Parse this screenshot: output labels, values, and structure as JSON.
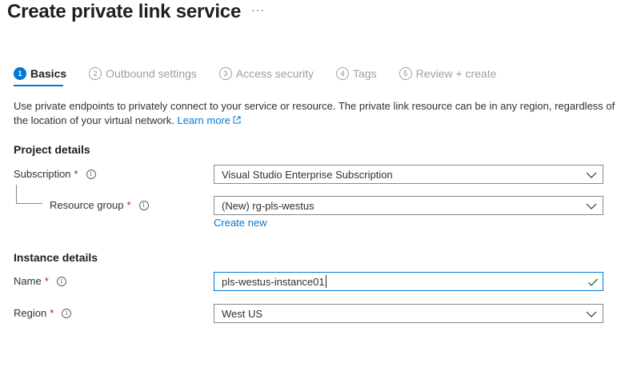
{
  "page": {
    "title": "Create private link service",
    "more_label": "···"
  },
  "tabs": [
    {
      "num": "1",
      "label": "Basics",
      "active": true
    },
    {
      "num": "2",
      "label": "Outbound settings",
      "active": false
    },
    {
      "num": "3",
      "label": "Access security",
      "active": false
    },
    {
      "num": "4",
      "label": "Tags",
      "active": false
    },
    {
      "num": "5",
      "label": "Review + create",
      "active": false
    }
  ],
  "description": {
    "text": "Use private endpoints to privately connect to your service or resource. The private link resource can be in any region, regardless of the location of your virtual network.",
    "link": "Learn more"
  },
  "project": {
    "heading": "Project details",
    "subscription": {
      "label": "Subscription",
      "required": "*",
      "value": "Visual Studio Enterprise Subscription"
    },
    "resource_group": {
      "label": "Resource group",
      "required": "*",
      "value": "(New) rg-pls-westus",
      "create_new": "Create new"
    }
  },
  "instance": {
    "heading": "Instance details",
    "name": {
      "label": "Name",
      "required": "*",
      "value": "pls-westus-instance01"
    },
    "region": {
      "label": "Region",
      "required": "*",
      "value": "West US"
    }
  },
  "icons": {
    "info": "info-icon",
    "dropdown": "chevron-down-icon",
    "valid": "checkmark-icon",
    "external": "external-link-icon"
  },
  "colors": {
    "accent": "#0078d4",
    "required": "#a4262c",
    "valid": "#107c10"
  }
}
